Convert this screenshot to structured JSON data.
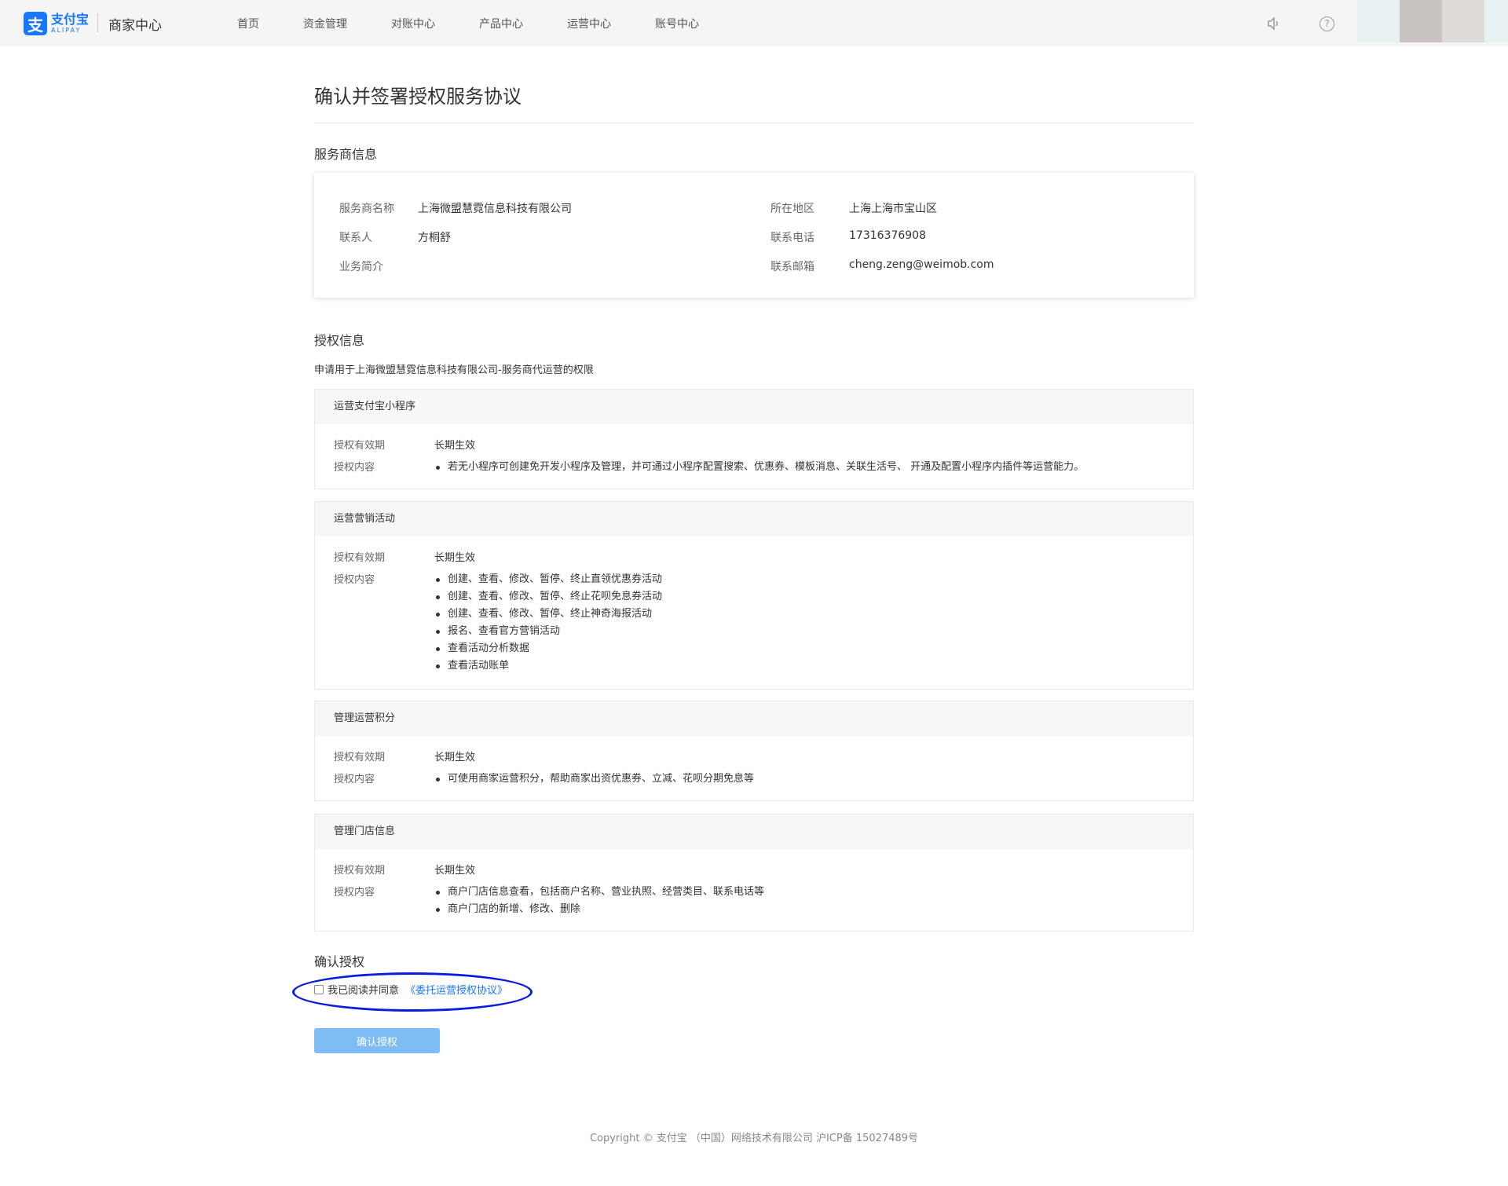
{
  "header": {
    "logo_mark": "支",
    "logo_cn": "支付宝",
    "logo_en": "ALIPAY",
    "brand_title": "商家中心",
    "nav": [
      "首页",
      "资金管理",
      "对账中心",
      "产品中心",
      "运营中心",
      "账号中心"
    ],
    "help_glyph": "?"
  },
  "page": {
    "title": "确认并签署授权服务协议"
  },
  "provider": {
    "section_title": "服务商信息",
    "name_label": "服务商名称",
    "name_value": "上海微盟慧霓信息科技有限公司",
    "region_label": "所在地区",
    "region_value": "上海上海市宝山区",
    "contact_label": "联系人",
    "contact_value": "方桐舒",
    "phone_label": "联系电话",
    "phone_value": "17316376908",
    "intro_label": "业务简介",
    "intro_value": "",
    "email_label": "联系邮箱",
    "email_value": "cheng.zeng@weimob.com"
  },
  "auth": {
    "section_title": "授权信息",
    "description": "申请用于上海微盟慧霓信息科技有限公司-服务商代运营的权限",
    "validity_label": "授权有效期",
    "content_label": "授权内容",
    "cards": [
      {
        "title": "运营支付宝小程序",
        "validity": "长期生效",
        "items": [
          "若无小程序可创建免开发小程序及管理，并可通过小程序配置搜索、优惠券、模板消息、关联生活号、 开通及配置小程序内插件等运营能力。"
        ]
      },
      {
        "title": "运营营销活动",
        "validity": "长期生效",
        "items": [
          "创建、查看、修改、暂停、终止直领优惠券活动",
          "创建、查看、修改、暂停、终止花呗免息券活动",
          "创建、查看、修改、暂停、终止神奇海报活动",
          "报名、查看官方营销活动",
          "查看活动分析数据",
          "查看活动账单"
        ]
      },
      {
        "title": "管理运营积分",
        "validity": "长期生效",
        "items": [
          "可使用商家运营积分，帮助商家出资优惠券、立减、花呗分期免息等"
        ]
      },
      {
        "title": "管理门店信息",
        "validity": "长期生效",
        "items": [
          "商户门店信息查看，包括商户名称、营业执照、经营类目、联系电话等",
          "商户门店的新增、修改、删除"
        ]
      }
    ]
  },
  "confirm": {
    "section_title": "确认授权",
    "agree_text": "我已阅读并同意",
    "agree_link": "《委托运营授权协议》",
    "agree_checked": false,
    "button_label": "确认授权"
  },
  "footer": {
    "copyright": "Copyright © 支付宝 （中国）网络技术有限公司 沪ICP备 15027489号"
  },
  "colors": {
    "brand_blue": "#1677ff",
    "button_blue": "#7dbcf4",
    "annotation_circle": "#0a1ae0"
  }
}
